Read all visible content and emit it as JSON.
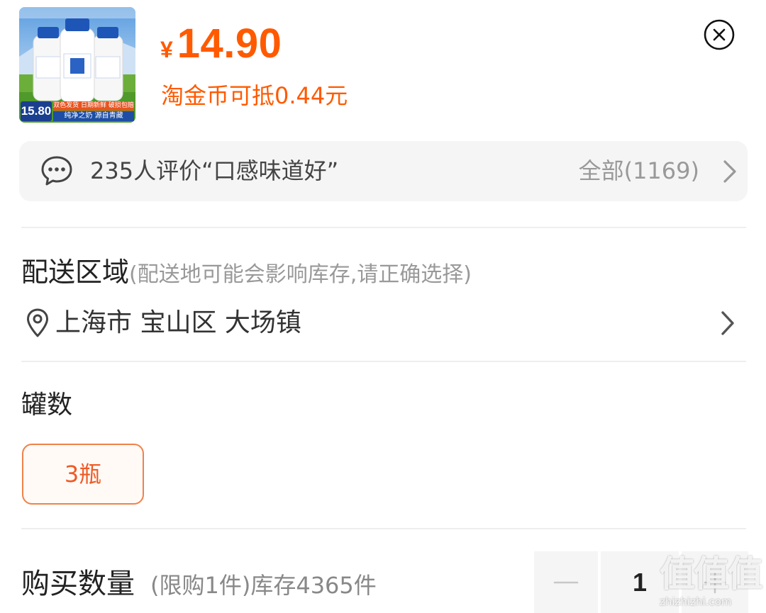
{
  "product": {
    "thumb_price": "15.80",
    "thumb_badge": "双色发货 日期新鲜 破损包赔",
    "thumb_slogan": "纯净之奶 源自青藏",
    "price_currency": "¥",
    "price_value": "14.90",
    "coin_deduct": "淘金币可抵0.44元"
  },
  "reviews": {
    "summary": "235人评价“口感味道好”",
    "all_label": "全部(1169)"
  },
  "delivery": {
    "title": "配送区域",
    "hint": "(配送地可能会影响库存,请正确选择)",
    "address": "上海市 宝山区 大场镇"
  },
  "spec": {
    "title": "罐数",
    "options": [
      {
        "label": "3瓶",
        "selected": true
      }
    ]
  },
  "quantity": {
    "title": "购买数量",
    "limit_info": "(限购1件)库存4365件",
    "value": "1"
  },
  "watermark": {
    "glyphs": "值值值",
    "url": "zhizhizhi.com"
  },
  "colors": {
    "accent": "#ff5a00",
    "spec_border": "#f0824a",
    "panel_bg": "#f5f5f5"
  },
  "icons": {
    "close": "close-circle-icon",
    "review": "chat-bubble-icon",
    "location": "location-pin-icon",
    "chevron": "chevron-right-icon",
    "minus": "minus-icon",
    "plus": "plus-icon"
  }
}
